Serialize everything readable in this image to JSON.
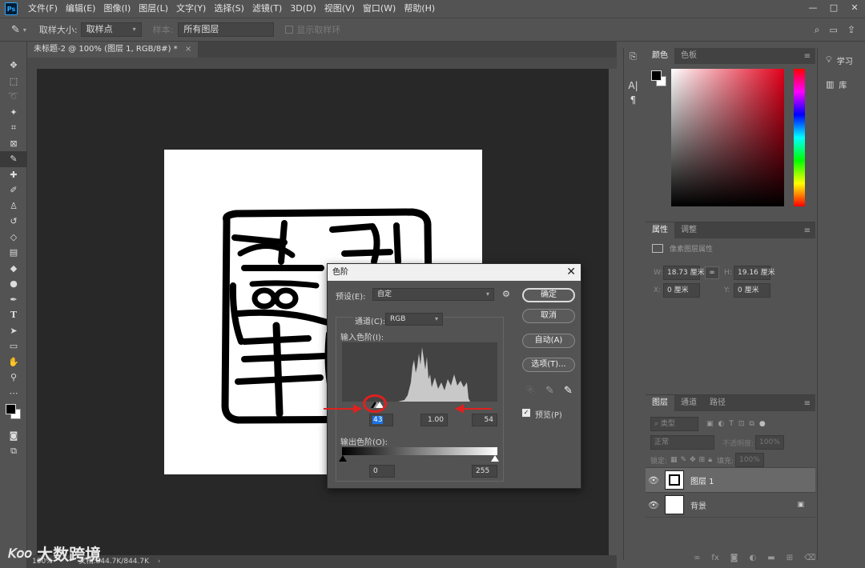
{
  "app": {
    "logo": "Ps",
    "menus": [
      "文件(F)",
      "编辑(E)",
      "图像(I)",
      "图层(L)",
      "文字(Y)",
      "选择(S)",
      "滤镜(T)",
      "3D(D)",
      "视图(V)",
      "窗口(W)",
      "帮助(H)"
    ],
    "window_controls": [
      "—",
      "□",
      "✕"
    ]
  },
  "options": {
    "sample_size_label": "取样大小:",
    "sample_size_value": "取样点",
    "sample_label": "样本:",
    "sample_value": "所有图层",
    "show_ring_label": "显示取样环"
  },
  "document": {
    "tab_title": "未标题-2 @ 100% (图层 1, RGB/8#) *",
    "tab_close": "×",
    "zoom": "100%",
    "doc_info": "文档:844.7K/844.7K"
  },
  "color_panel": {
    "tabs": [
      "颜色",
      "色板"
    ]
  },
  "properties_panel": {
    "tabs": [
      "属性",
      "调整"
    ],
    "subtitle": "像素图层属性",
    "w_label": "W:",
    "w_value": "18.73 厘米",
    "h_label": "H:",
    "h_value": "19.16 厘米",
    "x_label": "X:",
    "x_value": "0 厘米",
    "y_label": "Y:",
    "y_value": "0 厘米"
  },
  "layers_panel": {
    "tabs": [
      "图层",
      "通道",
      "路径"
    ],
    "filter_placeholder": "类型",
    "blend_mode": "正常",
    "opacity_label": "不透明度:",
    "opacity_value": "100%",
    "lock_label": "锁定:",
    "fill_label": "填充:",
    "fill_value": "100%",
    "layers": [
      {
        "name": "图层 1",
        "selected": true
      },
      {
        "name": "背景",
        "selected": false,
        "locked": true
      }
    ]
  },
  "learn_panel": {
    "items": [
      "学习",
      "库"
    ]
  },
  "levels_dialog": {
    "title": "色阶",
    "close": "✕",
    "preset_label": "预设(E):",
    "preset_value": "自定",
    "channel_label": "通道(C):",
    "channel_value": "RGB",
    "input_label": "输入色阶(I):",
    "input_black": "43",
    "input_gamma": "1.00",
    "input_white": "54",
    "output_label": "输出色阶(O):",
    "output_black": "0",
    "output_white": "255",
    "buttons": {
      "ok": "确定",
      "cancel": "取消",
      "auto": "自动(A)",
      "options": "选项(T)..."
    },
    "preview_label": "预览(P)",
    "preview_checked": true
  },
  "watermark": "大数跨境",
  "colors": {
    "ui_bg": "#535353",
    "canvas_bg": "#282828",
    "annotation_red": "#e0201e",
    "selection_blue": "#1a73e8"
  }
}
